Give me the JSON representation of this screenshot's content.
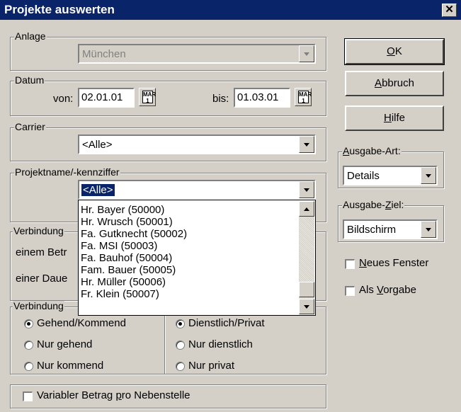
{
  "window": {
    "title": "Projekte auswerten",
    "close_glyph": "✕"
  },
  "anlage": {
    "legend": "Anlage",
    "value": "München"
  },
  "datum": {
    "legend": "Datum",
    "von_label": "von:",
    "von_value": "02.01.01",
    "bis_label": "bis:",
    "bis_value": "01.03.01",
    "calendar_label": "MAR 1"
  },
  "carrier": {
    "legend": "Carrier",
    "value": "<Alle>"
  },
  "projekt": {
    "legend": "Projektname/-kennziffer",
    "value": "<Alle>",
    "options": [
      "Hr. Bayer (50000)",
      "Hr. Wrusch (50001)",
      "Fa. Gutknecht (50002)",
      "Fa. MSI (50003)",
      "Fa. Bauhof (50004)",
      "Fam. Bauer (50005)",
      "Hr. Müller (50006)",
      "Fr. Klein (50007)"
    ]
  },
  "verbindung1": {
    "legend": "Verbindung",
    "row1": "einem Betr",
    "row2": "einer Daue"
  },
  "verbindung2": {
    "legend": "Verbindung",
    "left": [
      "Gehend/Kommend",
      "Nur gehend",
      "Nur kommend"
    ],
    "right": [
      "Dienstlich/Privat",
      "Nur dienstlich",
      "Nur privat"
    ]
  },
  "variabler": {
    "label_pre": "Variabler Betrag ",
    "label_ul": "p",
    "label_post": "ro Nebenstelle"
  },
  "buttons": {
    "ok": {
      "ul": "O",
      "rest": "K"
    },
    "abbruch": {
      "ul": "A",
      "rest": "bbruch"
    },
    "hilfe": {
      "ul": "H",
      "rest": "ilfe"
    }
  },
  "ausgabe_art": {
    "legend_pre": "A",
    "legend_post": "usgabe-Art:",
    "value": "Details"
  },
  "ausgabe_ziel": {
    "legend_pre": "Ausgabe-",
    "legend_ul": "Z",
    "legend_post": "iel:",
    "value": "Bildschirm"
  },
  "neues_fenster": {
    "ul": "N",
    "rest": "eues Fenster"
  },
  "als_vorgabe": {
    "pre": "Als ",
    "ul": "V",
    "rest": "orgabe"
  }
}
